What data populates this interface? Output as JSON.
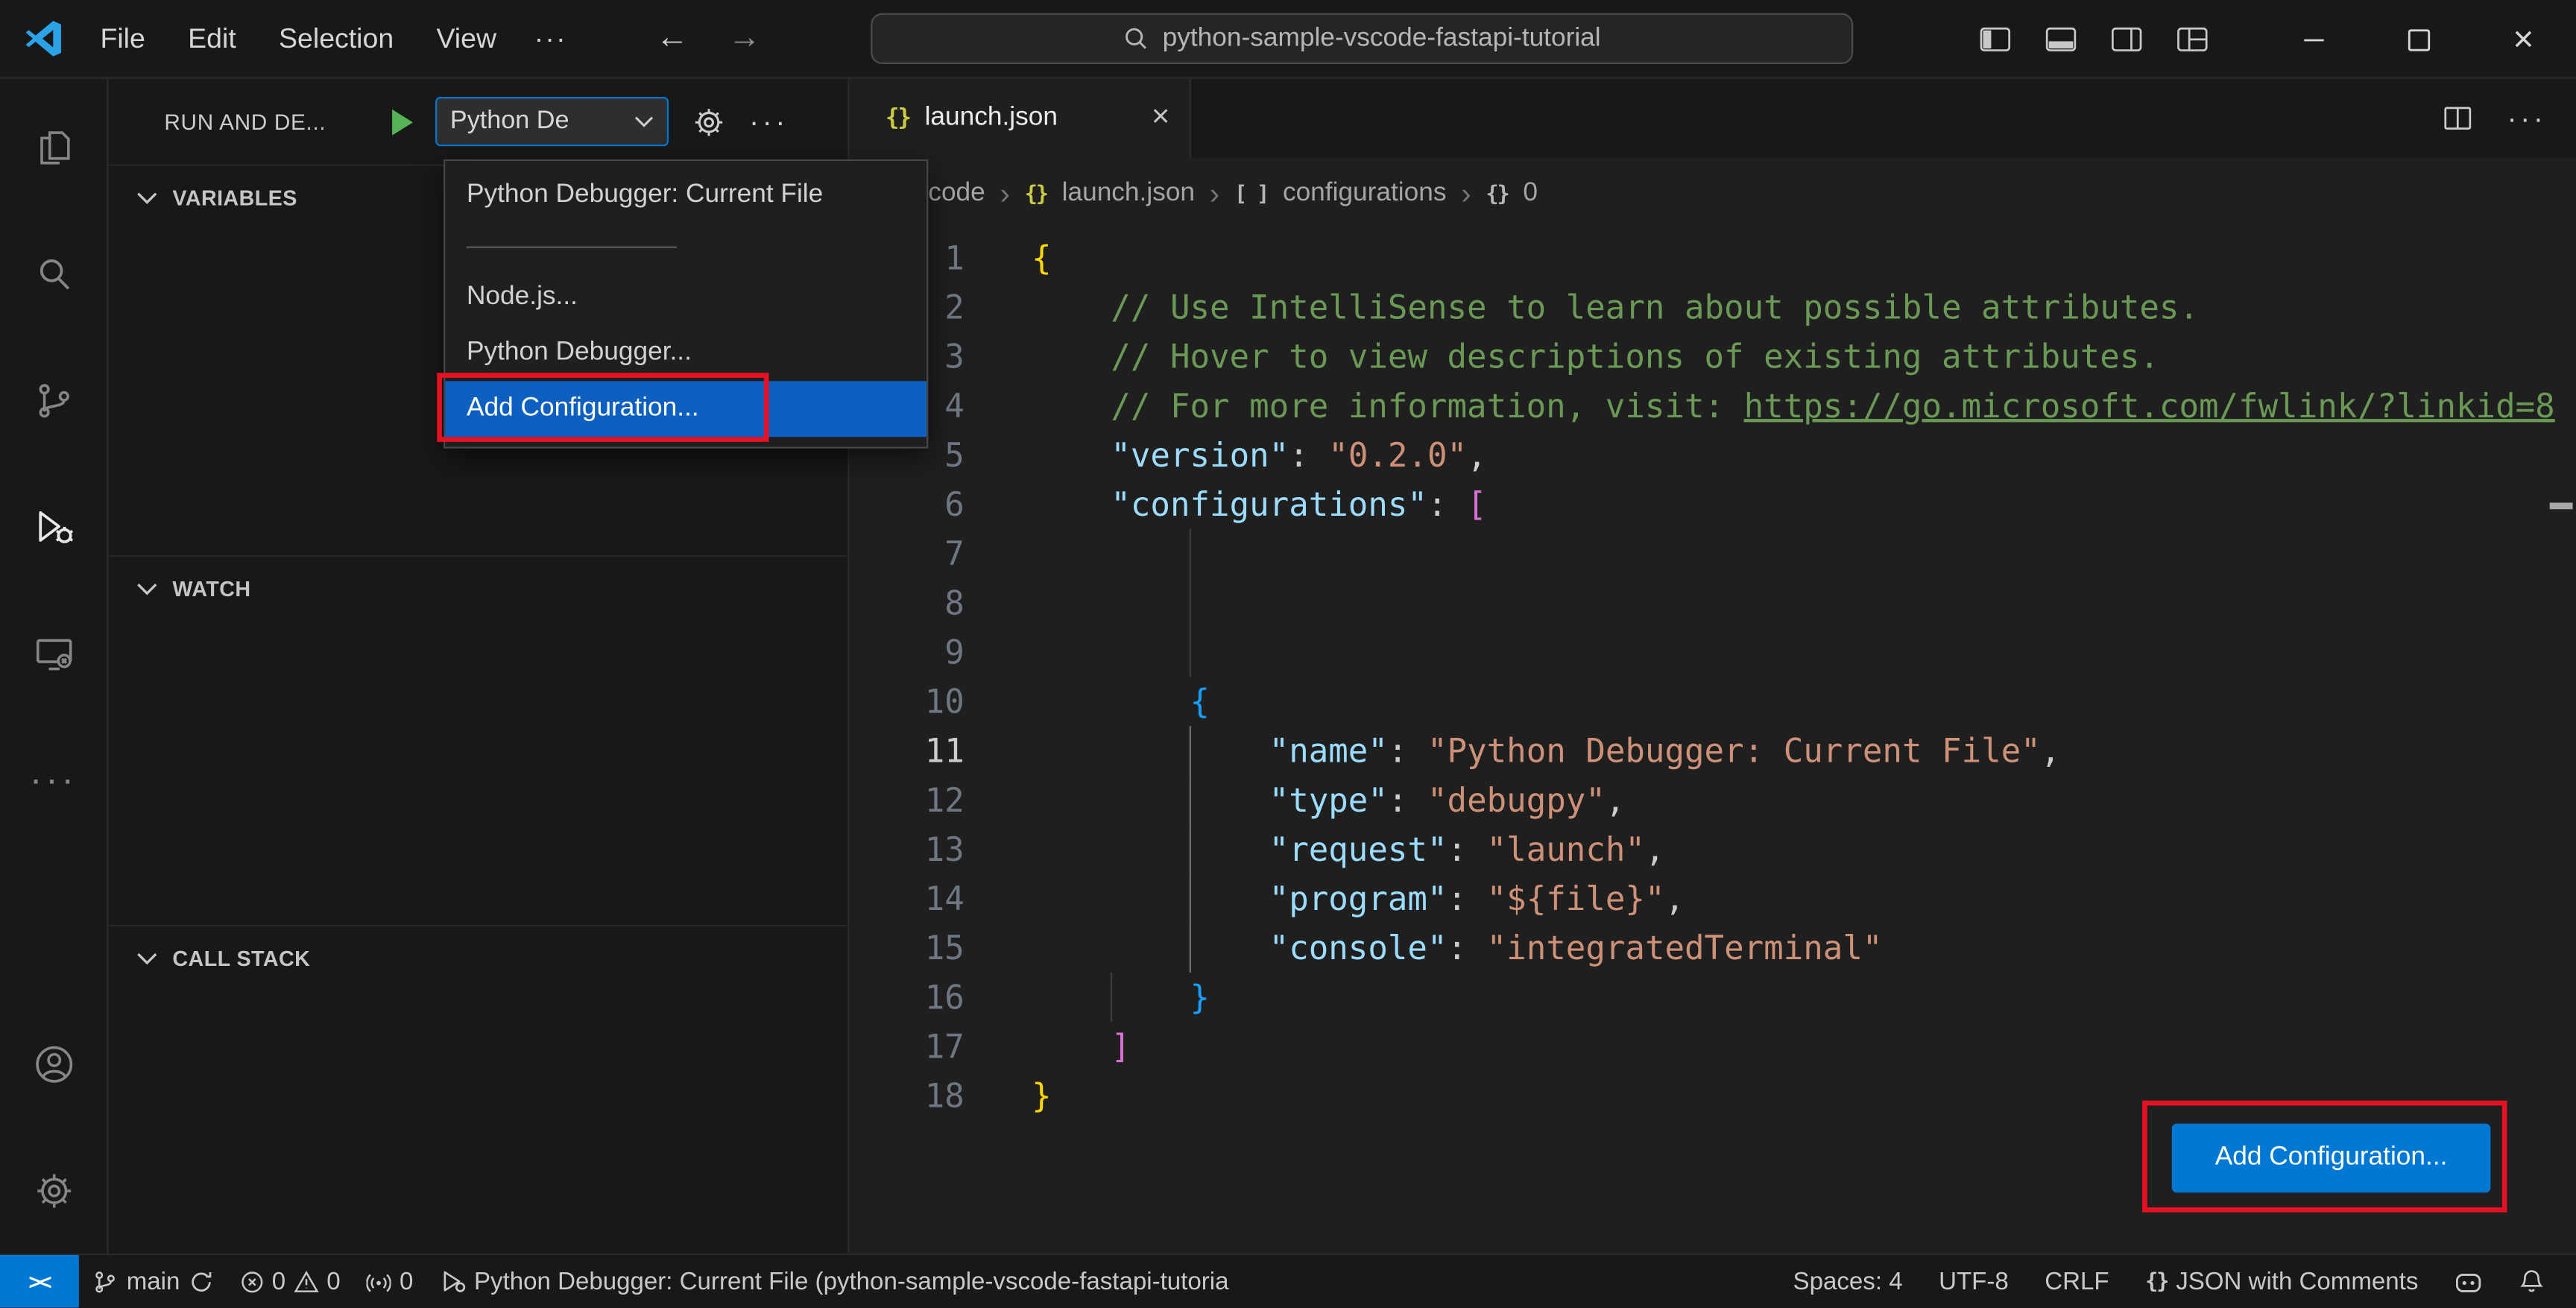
{
  "title_bar": {
    "menus": [
      "File",
      "Edit",
      "Selection",
      "View"
    ],
    "overflow_label": "···",
    "command_center": "python-sample-vscode-fastapi-tutorial"
  },
  "glyphs": {
    "ellipsis": "···",
    "close": "×",
    "chevron_right": "›",
    "remote": "><"
  },
  "sidebar": {
    "title": "RUN AND DE...",
    "config_select": "Python De",
    "sections": [
      "VARIABLES",
      "WATCH",
      "CALL STACK"
    ]
  },
  "debug_dropdown": {
    "items": [
      "Python Debugger: Current File",
      "Node.js...",
      "Python Debugger...",
      "Add Configuration..."
    ],
    "selected_index": 3
  },
  "editor": {
    "tab_label": "launch.json",
    "tab_icon": "{}",
    "breadcrumbs": [
      {
        "icon": "",
        "label": "code"
      },
      {
        "icon": "{}",
        "label": "launch.json"
      },
      {
        "icon": "[ ]",
        "label": "configurations"
      },
      {
        "icon": "{}",
        "label": "0"
      }
    ],
    "active_line": 11,
    "add_configuration_button": "Add Configuration...",
    "lines": [
      {
        "n": 1,
        "t": [
          [
            "{",
            "b1"
          ]
        ]
      },
      {
        "n": 2,
        "t": [
          [
            "    // Use IntelliSense to learn about possible attributes.",
            "cm"
          ]
        ]
      },
      {
        "n": 3,
        "t": [
          [
            "    // Hover to view descriptions of existing attributes.",
            "cm"
          ]
        ]
      },
      {
        "n": 4,
        "t": [
          [
            "    // For more information, visit: ",
            "cm"
          ],
          [
            "https://go.microsoft.com/fwlink/?linkid=8",
            "lk"
          ]
        ]
      },
      {
        "n": 5,
        "t": [
          [
            "    ",
            "p"
          ],
          [
            "\"version\"",
            "k"
          ],
          [
            ": ",
            "p"
          ],
          [
            "\"0.2.0\"",
            "s"
          ],
          [
            ",",
            "p"
          ]
        ]
      },
      {
        "n": 6,
        "t": [
          [
            "    ",
            "p"
          ],
          [
            "\"configurations\"",
            "k"
          ],
          [
            ": ",
            "p"
          ],
          [
            "[",
            "b2"
          ]
        ]
      },
      {
        "n": 7,
        "t": []
      },
      {
        "n": 8,
        "t": []
      },
      {
        "n": 9,
        "t": []
      },
      {
        "n": 10,
        "t": [
          [
            "        ",
            "p"
          ],
          [
            "{",
            "b3"
          ]
        ]
      },
      {
        "n": 11,
        "t": [
          [
            "            ",
            "p"
          ],
          [
            "\"name\"",
            "k"
          ],
          [
            ": ",
            "p"
          ],
          [
            "\"Python Debugger: Current File\"",
            "s"
          ],
          [
            ",",
            "p"
          ]
        ]
      },
      {
        "n": 12,
        "t": [
          [
            "            ",
            "p"
          ],
          [
            "\"type\"",
            "k"
          ],
          [
            ": ",
            "p"
          ],
          [
            "\"debugpy\"",
            "s"
          ],
          [
            ",",
            "p"
          ]
        ]
      },
      {
        "n": 13,
        "t": [
          [
            "            ",
            "p"
          ],
          [
            "\"request\"",
            "k"
          ],
          [
            ": ",
            "p"
          ],
          [
            "\"launch\"",
            "s"
          ],
          [
            ",",
            "p"
          ]
        ]
      },
      {
        "n": 14,
        "t": [
          [
            "            ",
            "p"
          ],
          [
            "\"program\"",
            "k"
          ],
          [
            ": ",
            "p"
          ],
          [
            "\"${file}\"",
            "s"
          ],
          [
            ",",
            "p"
          ]
        ]
      },
      {
        "n": 15,
        "t": [
          [
            "            ",
            "p"
          ],
          [
            "\"console\"",
            "k"
          ],
          [
            ": ",
            "p"
          ],
          [
            "\"integratedTerminal\"",
            "s"
          ]
        ]
      },
      {
        "n": 16,
        "t": [
          [
            "        ",
            "p"
          ],
          [
            "}",
            "b3"
          ]
        ]
      },
      {
        "n": 17,
        "t": [
          [
            "    ",
            "p"
          ],
          [
            "]",
            "b2"
          ]
        ]
      },
      {
        "n": 18,
        "t": [
          [
            "}",
            "b1"
          ]
        ]
      }
    ]
  },
  "status_bar": {
    "branch": "main",
    "errors": "0",
    "warnings": "0",
    "ports": "0",
    "debug_status": "Python Debugger: Current File (python-sample-vscode-fastapi-tutoria",
    "indentation": "Spaces: 4",
    "encoding": "UTF-8",
    "eol": "CRLF",
    "language": "JSON with Comments",
    "language_icon": "{}"
  },
  "colors": {
    "accent": "#0078d4",
    "annotation_red": "#e81123",
    "list_selection": "#0d60c0",
    "json_yellow": "#cbcb41",
    "play_green": "#55b455",
    "tok_p": "#cccccc",
    "tok_cm": "#6a9955",
    "tok_k": "#9cdcfe",
    "tok_s": "#ce9178",
    "tok_b1": "#ffd700",
    "tok_b2": "#da70d6",
    "tok_b3": "#179fff"
  }
}
